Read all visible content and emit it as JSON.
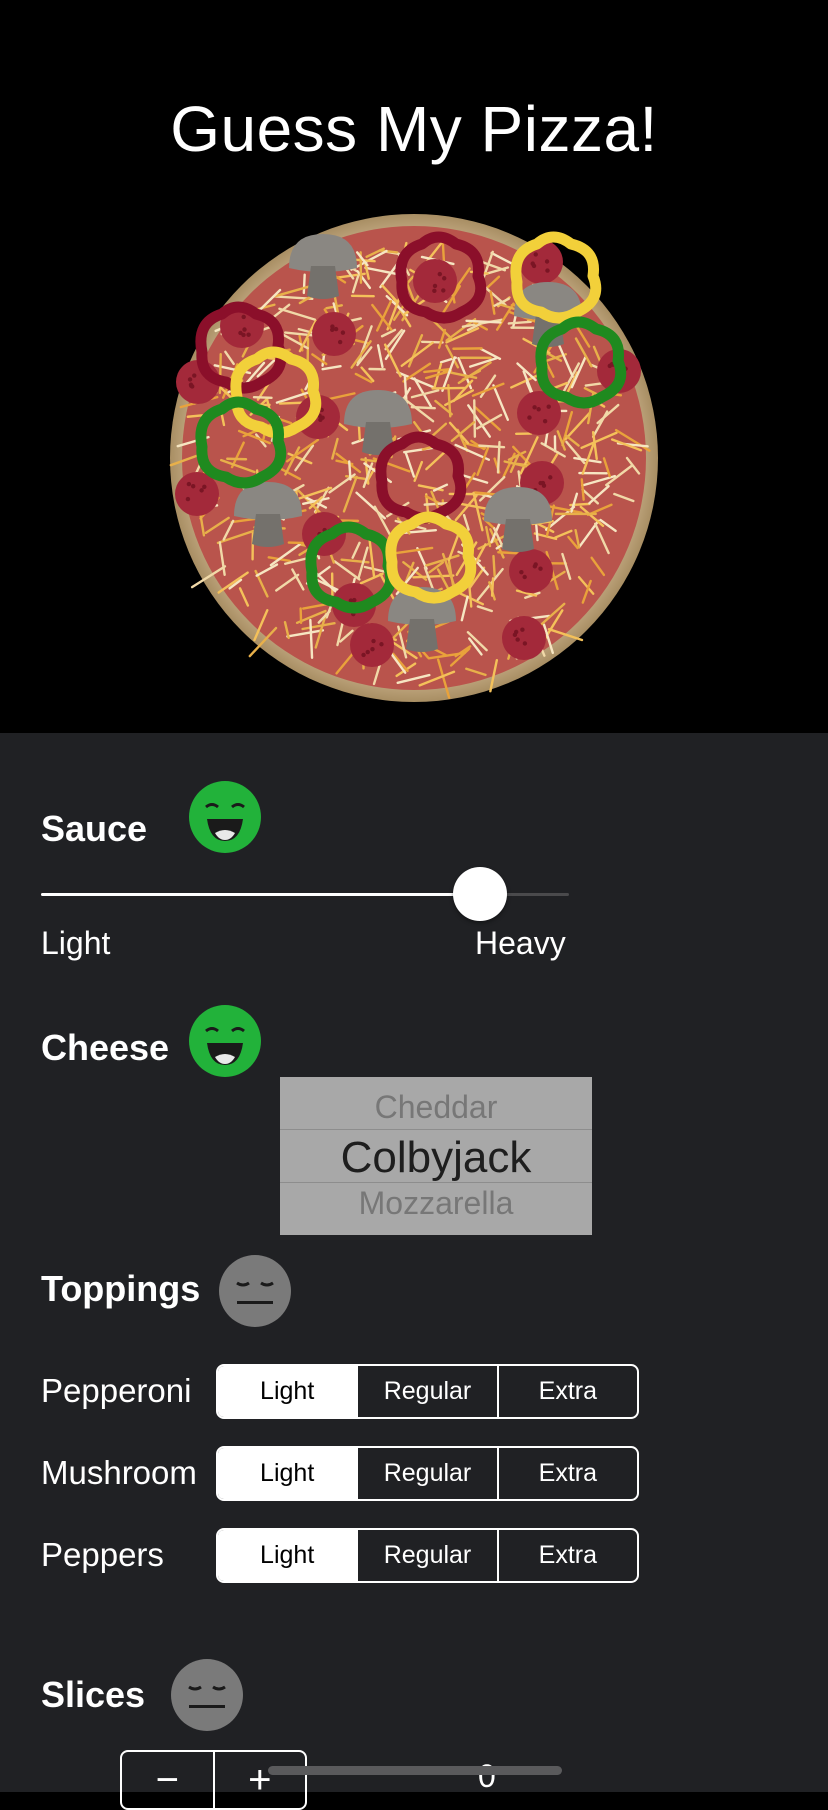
{
  "header": {
    "title": "Guess My Pizza!"
  },
  "sauce": {
    "title": "Sauce",
    "status_icon": "happy-face-icon",
    "status_color": "#22b23a",
    "min_label": "Light",
    "max_label": "Heavy",
    "value_fraction": 0.82
  },
  "cheese": {
    "title": "Cheese",
    "status_icon": "happy-face-icon",
    "status_color": "#22b23a",
    "options_visible": [
      "Cheddar",
      "Colbyjack",
      "Mozzarella"
    ],
    "selected": "Colbyjack"
  },
  "toppings": {
    "title": "Toppings",
    "status_icon": "neutral-face-icon",
    "status_color": "#7a7a7a",
    "items": [
      {
        "name": "Pepperoni",
        "segments": [
          "Light",
          "Regular",
          "Extra"
        ],
        "selected": "Light"
      },
      {
        "name": "Mushroom",
        "segments": [
          "Light",
          "Regular",
          "Extra"
        ],
        "selected": "Light"
      },
      {
        "name": "Peppers",
        "segments": [
          "Light",
          "Regular",
          "Extra"
        ],
        "selected": "Light"
      }
    ]
  },
  "slices": {
    "title": "Slices",
    "status_icon": "neutral-face-icon",
    "status_color": "#7a7a7a",
    "minus_label": "−",
    "plus_label": "+",
    "value": "0"
  },
  "colors": {
    "background": "#000000",
    "panel": "#202124",
    "crust": "#c9b08a",
    "sauce": "#b9544c"
  }
}
